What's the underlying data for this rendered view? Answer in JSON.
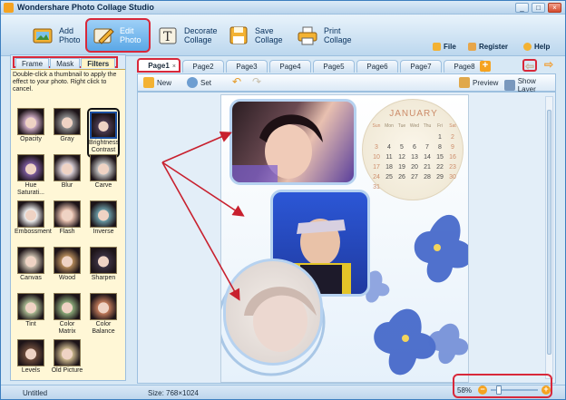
{
  "window": {
    "title": "Wondershare Photo Collage Studio",
    "controls": [
      "_",
      "□",
      "×"
    ]
  },
  "toolbar": {
    "items": [
      {
        "label": "Add\nPhoto",
        "icon": "add-photo-icon"
      },
      {
        "label": "Edit\nPhoto",
        "icon": "edit-photo-icon",
        "active": true
      },
      {
        "label": "Decorate\nCollage",
        "icon": "decorate-collage-icon"
      },
      {
        "label": "Save\nCollage",
        "icon": "save-collage-icon"
      },
      {
        "label": "Print\nCollage",
        "icon": "print-collage-icon"
      }
    ],
    "menu": [
      {
        "label": "File",
        "icon": "file-icon"
      },
      {
        "label": "Register",
        "icon": "register-icon"
      },
      {
        "label": "Help",
        "icon": "help-icon"
      }
    ]
  },
  "left_panel": {
    "tabs": [
      "Frame",
      "Mask",
      "Filters"
    ],
    "selected_tab": "Filters",
    "hint": "Double-click a thumbnail to apply the effect to your photo. Right click to cancel.",
    "filters": [
      {
        "label": "Opacity"
      },
      {
        "label": "Gray"
      },
      {
        "label": "Brightness\nContrast",
        "selected": true
      },
      {
        "label": "Hue\nSaturati..."
      },
      {
        "label": "Blur"
      },
      {
        "label": "Carve"
      },
      {
        "label": "Embossment"
      },
      {
        "label": "Flash"
      },
      {
        "label": "Inverse"
      },
      {
        "label": "Canvas"
      },
      {
        "label": "Wood"
      },
      {
        "label": "Sharpen"
      },
      {
        "label": "Tint"
      },
      {
        "label": "Color Matrix"
      },
      {
        "label": "Color\nBalance"
      },
      {
        "label": "Levels"
      },
      {
        "label": "Old Picture"
      }
    ]
  },
  "pages": {
    "tabs": [
      "Page1",
      "Page2",
      "Page3",
      "Page4",
      "Page5",
      "Page6",
      "Page7",
      "Page8"
    ],
    "selected": "Page1",
    "close_glyph": "×",
    "add_glyph": "+",
    "nav": {
      "prev": "⇦",
      "next": "⇨"
    }
  },
  "subbar": {
    "new_label": "New",
    "set_label": "Set",
    "undo": "↶",
    "redo": "↷",
    "preview_label": "Preview",
    "show_layer_label": "Show Layer"
  },
  "calendar": {
    "month": "JANUARY",
    "days_of_week": [
      "Sun",
      "Mon",
      "Tue",
      "Wed",
      "Thu",
      "Fri",
      "Sat"
    ],
    "weeks": [
      [
        "",
        "",
        "",
        "",
        "",
        "1",
        "2"
      ],
      [
        "3",
        "4",
        "5",
        "6",
        "7",
        "8",
        "9"
      ],
      [
        "10",
        "11",
        "12",
        "13",
        "14",
        "15",
        "16"
      ],
      [
        "17",
        "18",
        "19",
        "20",
        "21",
        "22",
        "23"
      ],
      [
        "24",
        "25",
        "26",
        "27",
        "28",
        "29",
        "30"
      ],
      [
        "31",
        "",
        "",
        "",
        "",
        "",
        ""
      ]
    ]
  },
  "status": {
    "left": "Untitled",
    "size": "Size:  768×1024",
    "zoom": "58%",
    "zoom_value": 0.58,
    "minus": "−",
    "plus": "+"
  },
  "colors": {
    "accent": "#d8283a",
    "brand_orange": "#f5a321",
    "panel_bg": "#fff7d6",
    "window_blue": "#3d7fbf"
  }
}
